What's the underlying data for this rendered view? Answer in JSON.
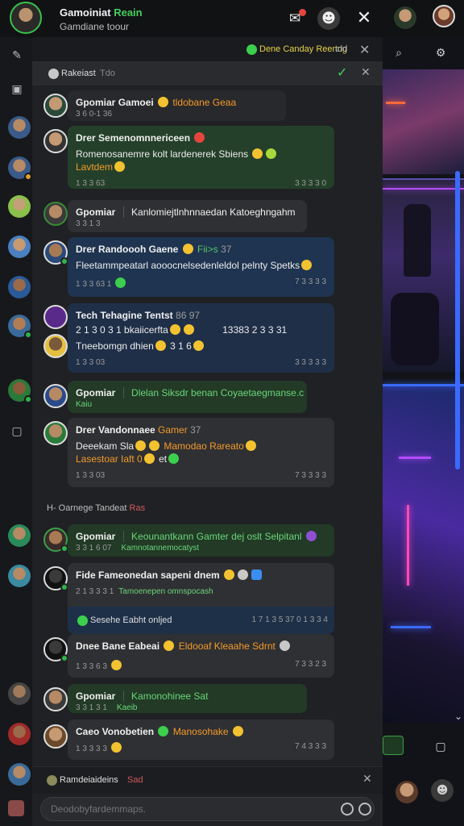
{
  "topbar": {
    "title_main": "Gamoiniat",
    "title_accent": "Reain",
    "subtitle": "Gamdiane toour",
    "accent_color": "#46d05c"
  },
  "filter_bar": {
    "status_label": "Dene Canday Reenng",
    "status_suffix": "tdd"
  },
  "pinned": {
    "label": "Rakeiast",
    "suffix": "Tdo"
  },
  "messages": [
    {
      "name": "Gpomiar",
      "name_suffix": "Gamoei",
      "accent": "tldobane Geaa",
      "time": "3 6 0-1 36"
    },
    {
      "name": "Drer Semenomnnericeen",
      "text": "Romenosanemre kolt lardenerek Sbiens",
      "text_line2": "Lavtdem",
      "time": "1 3 3 63",
      "time_right": "3 3 3 3 0"
    },
    {
      "name": "Gpomiar",
      "name_suffix": "3 3 1 3",
      "text": "Kanlomiejtlnhnnaedan Katoeghngahm"
    },
    {
      "name": "Drer Randoooh Gaene",
      "name_suffix": "Fii>s",
      "name_suffix2": "37",
      "text": "Fleetammpeatarl aooocnelsedenleldol pelnty Spetks",
      "time": "1 3 3 63 1",
      "time_right": "7 3 3 3 3"
    },
    {
      "name": "Tech Tehagine Tentst",
      "name_suffix": "86 97",
      "text": "2 1 3 0 3 1 bkaiicerfta",
      "text_mid": "13383 2 3 3 31",
      "text_line2": "Tneebomgn dhien",
      "text_line2_suffix": "3 1 6",
      "time": "1 3 3 03",
      "time_right": "3 3 3 3 3"
    },
    {
      "name": "Gpomiar",
      "name_suffix": "Kaiu",
      "text": "Dlelan Siksdr benan Coyaetaegmanse.c"
    },
    {
      "name": "Drer Vandonnaee",
      "name_suffix": "Gamer",
      "name_suffix2": "37",
      "text": "Deeekam Sla",
      "text_accent": "Mamodao Rareato",
      "text_line2": "Lasestoar Iaft 0",
      "text_line2_suffix": "et",
      "time": "1 3 3 03",
      "time_right": "7 3 3 3 3"
    }
  ],
  "divider": {
    "label": "H- Oarnege Tandeat",
    "suffix": "Ras"
  },
  "messages2": [
    {
      "name": "Gpomiar",
      "name_suffix": "3 3 1 6 07",
      "text": "Keounantkann Gamter dej oslt Selpitanl",
      "text_line2": "Kamnotannemocatyst"
    },
    {
      "name": "Fide Fameonedan sapeni dnem",
      "text": "2 1 3 3 3 1",
      "text_accent": "Tamoenepen omnspocash",
      "footer": "Sesehe Eabht onljed",
      "footer_time": "1 7 1 3 5 37 0 1 3 3 4"
    },
    {
      "name": "Dnee Bane Eabeai",
      "name_accent": "Eldooaf Kleaahe Sdrnt",
      "time": "1 3 3 6 3",
      "time_right": "7 3 3 2 3"
    },
    {
      "name": "Gpomiar",
      "name_suffix": "3 3 1 3 1",
      "text": "Kamonohinee Sat",
      "text_line2": "Kaeib"
    },
    {
      "name": "Caeo Vonobetien",
      "name_accent": "Manosohake",
      "time": "1 3 3 3 3",
      "time_right": "7 4 3 3 3"
    }
  ],
  "reply_bar": {
    "label": "Ramdeiaideins",
    "suffix": "Sad"
  },
  "composer": {
    "placeholder": "Deodobyfardemmaps."
  }
}
